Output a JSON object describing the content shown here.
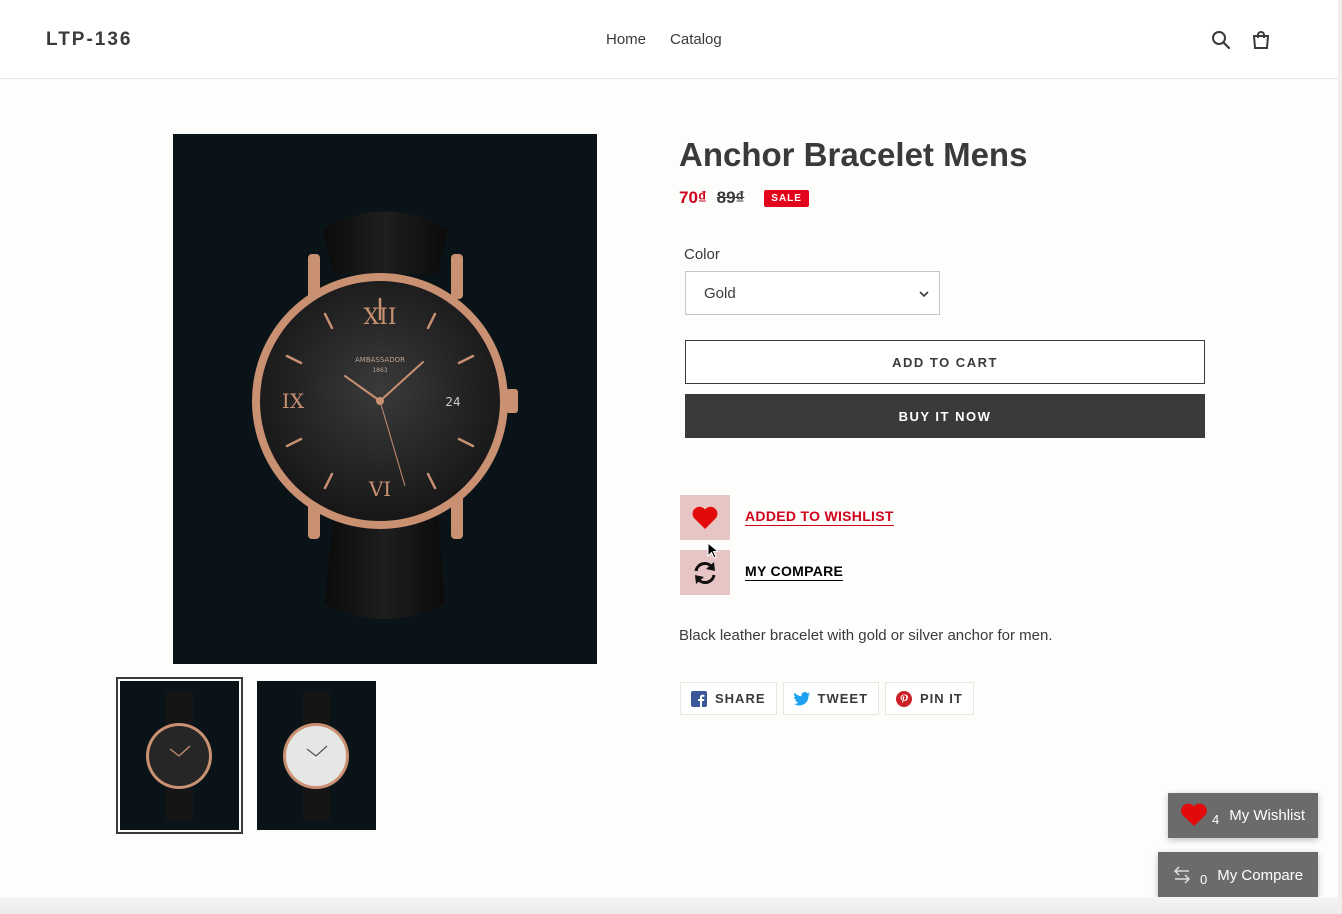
{
  "header": {
    "logo": "LTP-136",
    "nav": [
      "Home",
      "Catalog"
    ],
    "icons": [
      "search-icon",
      "cart-icon"
    ]
  },
  "product": {
    "title": "Anchor Bracelet Mens",
    "price_sale": "70₫",
    "price_regular": "89₫",
    "sale_badge": "SALE",
    "option_label": "Color",
    "option_value": "Gold",
    "add_to_cart": "ADD TO CART",
    "buy_now": "BUY IT NOW",
    "wishlist_label": "ADDED TO WISHLIST",
    "compare_label": "MY COMPARE",
    "description": "Black leather bracelet with gold or silver anchor for men."
  },
  "share": {
    "facebook": "SHARE",
    "twitter": "TWEET",
    "pinterest": "PIN IT"
  },
  "floating": {
    "wishlist_count": "4",
    "wishlist_label": "My Wishlist",
    "compare_count": "0",
    "compare_label": "My Compare"
  },
  "colors": {
    "sale_red": "#d0021b",
    "dark": "#3a3a3a",
    "wishlist_box": "#e8c5c5",
    "floating_bg": "#6b6b6b"
  }
}
